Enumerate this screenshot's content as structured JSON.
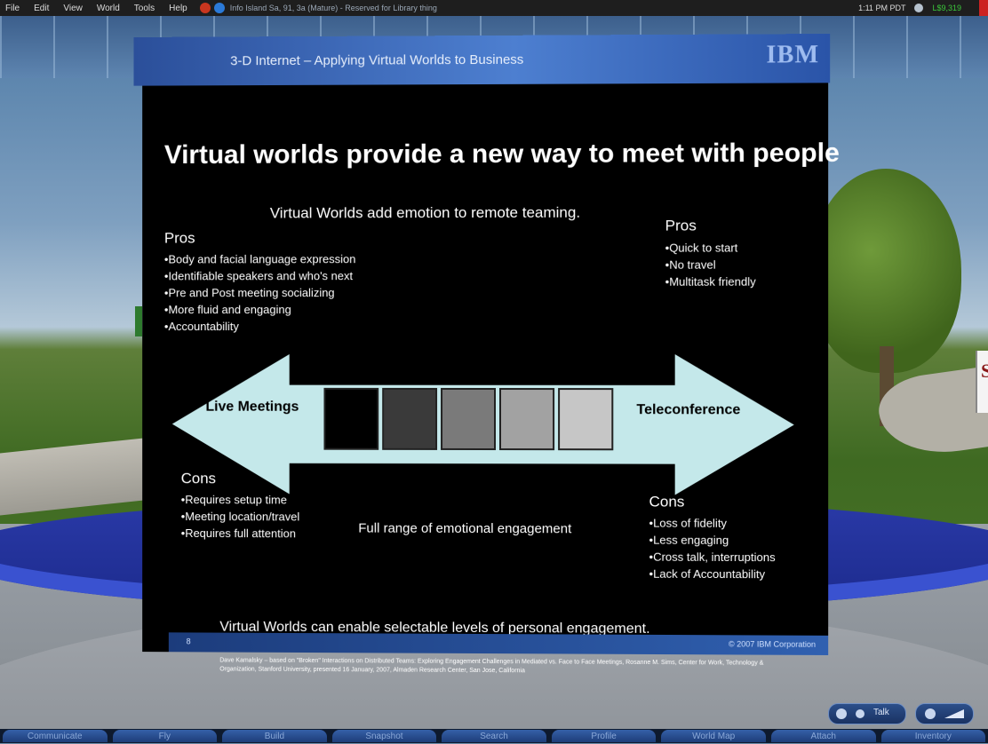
{
  "menu": {
    "items": [
      "File",
      "Edit",
      "View",
      "World",
      "Tools",
      "Help"
    ],
    "location": "Info Island Sa, 91, 3a (Mature) - Reserved for Library thing",
    "clock": "1:11 PM PDT",
    "balance": "L$9,319"
  },
  "slide": {
    "header_title": "3-D Internet – Applying Virtual Worlds to Business",
    "logo": "IBM",
    "headline": "Virtual worlds provide a new way to meet with people",
    "subheadline": "Virtual Worlds add emotion to remote teaming.",
    "left_pros_title": "Pros",
    "left_pros": [
      "Body and facial language expression",
      "Identifiable speakers and who's next",
      "Pre and Post meeting socializing",
      "More fluid and engaging",
      "Accountability"
    ],
    "right_pros_title": "Pros",
    "right_pros": [
      "Quick to start",
      "No travel",
      "Multitask friendly"
    ],
    "arrow_left_label": "Live Meetings",
    "arrow_right_label": "Teleconference",
    "swatch_colors": [
      "#000000",
      "#3a3a3a",
      "#7a7a7a",
      "#a2a2a2",
      "#c6c6c6"
    ],
    "left_cons_title": "Cons",
    "left_cons": [
      "Requires setup time",
      "Meeting location/travel",
      "Requires full attention"
    ],
    "range_label": "Full range of emotional engagement",
    "right_cons_title": "Cons",
    "right_cons": [
      "Loss of fidelity",
      "Less engaging",
      "Cross talk, interruptions",
      "Lack of Accountability"
    ],
    "bottom_line": "Virtual Worlds can enable selectable levels of personal engagement.",
    "citation": "Dave Kamalsky – based on \"Broken\" Interactions on Distributed Teams: Exploring Engagement Challenges in Mediated vs. Face to Face Meetings, Rosanne M. Sims, Center for Work, Technology & Organization, Stanford University, presented 16 January, 2007, Almaden Research Center, San Jose, California",
    "page_number": "8",
    "copyright": "© 2007 IBM Corporation"
  },
  "scene": {
    "sign_text": "S"
  },
  "hud": {
    "talk_label": "Talk"
  },
  "toolbar": {
    "buttons": [
      "Communicate",
      "Fly",
      "Build",
      "Snapshot",
      "Search",
      "Profile",
      "World Map",
      "Attach",
      "Inventory"
    ]
  },
  "colors": {
    "menubar": "#1e1e1e",
    "slide_header": "#3e6dc0",
    "arrow": "#c4e8ea",
    "balance": "#3bc83b"
  }
}
